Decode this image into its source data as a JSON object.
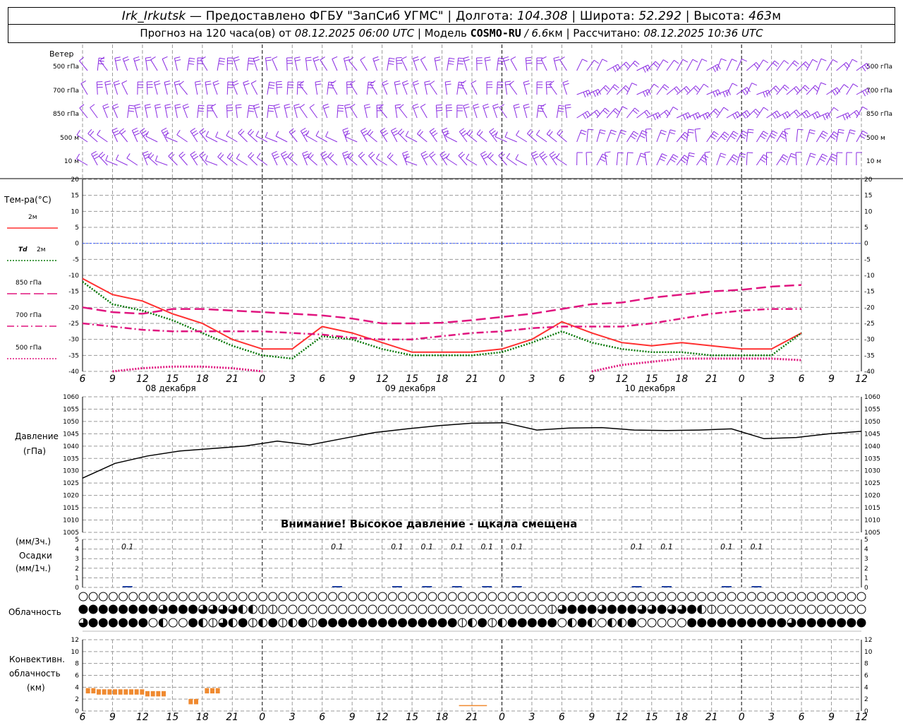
{
  "header": {
    "station": "Irk_Irkutsk",
    "provider": " — Предоставлено ФГБУ \"ЗапСиб УГМС\" | Долгота: ",
    "lon": "104.308",
    "lat_label": " | Широта: ",
    "lat": "52.292",
    "alt_label": " | Высота: ",
    "alt": "463",
    "alt_unit": "м",
    "fc_label": "Прогноз на 120 часа(ов) от ",
    "fc_time": "08.12.2025 06:00 UTC",
    "model_label": " | Модель ",
    "model": "COSMO-RU",
    "res": " / 6.6",
    "res_unit": "км",
    "calc_label": " | Рассчитано: ",
    "calc_time": "08.12.2025 10:36 UTC"
  },
  "wind_panel": {
    "title": "Ветер",
    "levels": [
      "500 гПа",
      "700 гПа",
      "850 гПа",
      "500 м",
      "10   м"
    ],
    "color": "#8a2be2"
  },
  "x_axis": {
    "ticks": [
      "6",
      "9",
      "12",
      "15",
      "18",
      "21",
      "0",
      "3",
      "6",
      "9",
      "12",
      "15",
      "18",
      "21",
      "0",
      "3",
      "6",
      "9",
      "12",
      "15",
      "18",
      "21",
      "0",
      "3",
      "6",
      "9",
      "12"
    ],
    "dates": [
      "08 декабря",
      "09 декабря",
      "10 декабря"
    ]
  },
  "temp_panel": {
    "title": "Тем-ра(°C)",
    "legend": [
      {
        "label": "2м",
        "color": "#ff3030",
        "style": "solid"
      },
      {
        "label": "Td",
        "label2": "2м",
        "color": "#0a7a0a",
        "style": "dotted"
      },
      {
        "label": "850 гПа",
        "color": "#e0157f",
        "style": "long-dash"
      },
      {
        "label": "700 гПа",
        "color": "#e0157f",
        "style": "dash-dot"
      },
      {
        "label": "500 гПа",
        "color": "#e0157f",
        "style": "dotted"
      }
    ],
    "yticks": [
      "20",
      "15",
      "10",
      "5",
      "0",
      "-5",
      "-10",
      "-15",
      "-20",
      "-25",
      "-30",
      "-35",
      "-40"
    ]
  },
  "pressure_panel": {
    "title1": "Давление",
    "title2": "(гПа)",
    "yticks": [
      "1060",
      "1055",
      "1050",
      "1045",
      "1040",
      "1035",
      "1030",
      "1025",
      "1020",
      "1015",
      "1010",
      "1005"
    ],
    "warning": "Внимание! Высокое давление - щкала смещена"
  },
  "precip_panel": {
    "unit1": "(мм/3ч.)",
    "title": "Осадки",
    "unit2": "(мм/1ч.)",
    "yticks": [
      "5",
      "4",
      "3",
      "2",
      "1",
      "0"
    ],
    "labels": [
      {
        "t": 3,
        "text": "0.1"
      },
      {
        "t": 24,
        "text": "0.1"
      },
      {
        "t": 30,
        "text": "0.1"
      },
      {
        "t": 33,
        "text": "0.1"
      },
      {
        "t": 36,
        "text": "0.1"
      },
      {
        "t": 39,
        "text": "0.1"
      },
      {
        "t": 42,
        "text": "0.1"
      },
      {
        "t": 54,
        "text": "0.1"
      },
      {
        "t": 57,
        "text": "0.1"
      },
      {
        "t": 63,
        "text": "0.1"
      },
      {
        "t": 66,
        "text": "0.1"
      }
    ]
  },
  "cloud_panel": {
    "title": "Облачность"
  },
  "conv_panel": {
    "title1": "Конвективн.",
    "title2": "облачность",
    "title3": "(км)",
    "yticks": [
      "12",
      "10",
      "8",
      "6",
      "4",
      "2",
      "0"
    ],
    "color": "#f08a30"
  },
  "chart_data": [
    {
      "type": "line",
      "title": "Тем-ра(°C)",
      "x_hours_from_start": [
        0,
        3,
        6,
        9,
        12,
        15,
        18,
        21,
        24,
        27,
        30,
        33,
        36,
        39,
        42,
        45,
        48,
        51,
        54,
        57,
        60,
        63,
        66,
        69,
        72
      ],
      "ylim": [
        -40,
        20
      ],
      "series": [
        {
          "name": "2м",
          "values": [
            -11,
            -16,
            -18,
            -22,
            -25,
            -30,
            -33,
            -33,
            -26,
            -28,
            -31,
            -34,
            -34,
            -34,
            -33,
            -30,
            -24.5,
            -28,
            -31,
            -32,
            -31,
            -32,
            -33,
            -33,
            -28
          ]
        },
        {
          "name": "Td 2м",
          "values": [
            -12,
            -19,
            -21,
            -24,
            -28,
            -32,
            -35,
            -36,
            -29,
            -30,
            -33,
            -35,
            -35,
            -35,
            -34,
            -31,
            -27.5,
            -31,
            -33,
            -34,
            -34,
            -35,
            -35,
            -35,
            -28
          ]
        },
        {
          "name": "850 гПа",
          "values": [
            -20,
            -21.5,
            -22,
            -20.5,
            -20.5,
            -21,
            -21.5,
            -22,
            -22.5,
            -23.5,
            -25,
            -25,
            -24.8,
            -24,
            -23,
            -22,
            -20.5,
            -19,
            -18.5,
            -17,
            -16,
            -15,
            -14.5,
            -13.5,
            -13
          ]
        },
        {
          "name": "700 гПа",
          "values": [
            -25,
            -26,
            -27,
            -27.5,
            -27.5,
            -27.5,
            -27.5,
            -28,
            -28.5,
            -29.5,
            -30,
            -30,
            -29,
            -28,
            -27.5,
            -26.5,
            -26,
            -26,
            -26,
            -25,
            -23.5,
            -22,
            -21,
            -20.5,
            -20.5
          ]
        },
        {
          "name": "500 гПа",
          "values": [
            null,
            -40,
            -39,
            -38.5,
            -38.5,
            -39,
            -40,
            null,
            null,
            null,
            null,
            null,
            null,
            null,
            null,
            null,
            null,
            -40,
            -38,
            -37,
            -36,
            -36,
            -36,
            -36,
            -36.5
          ]
        }
      ]
    },
    {
      "type": "line",
      "title": "Давление (гПа)",
      "x_hours_from_start": [
        0,
        3,
        6,
        9,
        12,
        15,
        18,
        21,
        24,
        27,
        30,
        33,
        36,
        39,
        42,
        45,
        48,
        51,
        54,
        57,
        60,
        63,
        66,
        69,
        72
      ],
      "ylim": [
        1005,
        1060
      ],
      "series": [
        {
          "name": "Давление",
          "values": [
            1027,
            1033,
            1036,
            1038,
            1039,
            1040,
            1042,
            1040.5,
            1043,
            1045.5,
            1047,
            1048.3,
            1049.3,
            1049.5,
            1046.5,
            1047.3,
            1047.5,
            1046.5,
            1046.3,
            1046.5,
            1047,
            1043,
            1043.5,
            1045,
            1046
          ]
        }
      ]
    },
    {
      "type": "bar",
      "title": "Конвективн. облачность (км)",
      "x_hours_from_start": [
        0.5,
        1,
        1.5,
        2,
        2.5,
        3,
        3.5,
        4,
        4.5,
        5,
        5.5,
        6,
        6.5,
        7,
        7.5,
        8,
        8.5,
        9,
        9.5,
        10,
        10.5,
        11,
        11.5,
        12,
        12.5,
        13
      ],
      "ylim": [
        0,
        13
      ],
      "values": [
        3.8,
        3.8,
        3.6,
        3.6,
        3.6,
        3.6,
        3.6,
        3.6,
        3.6,
        3.6,
        3.6,
        3.3,
        3.3,
        3.3,
        3.3,
        0,
        0,
        0,
        0,
        2,
        2,
        0,
        3.8,
        3.8,
        3.8,
        0
      ]
    }
  ],
  "cloud_rows": {
    "row1": "000000000000000000000000000000000000000000000000000000000000000000000000000000000000000000000000000000000000000000000000",
    "row2": "444444443444333322110000000000000000000000000001344434443343342100000000000000000000000000000000000000000000000000000000",
    "row3": "344444402004213241241241444444444444441241244444024202240000044444444443444444442440000000000000000000000000000000000000"
  }
}
